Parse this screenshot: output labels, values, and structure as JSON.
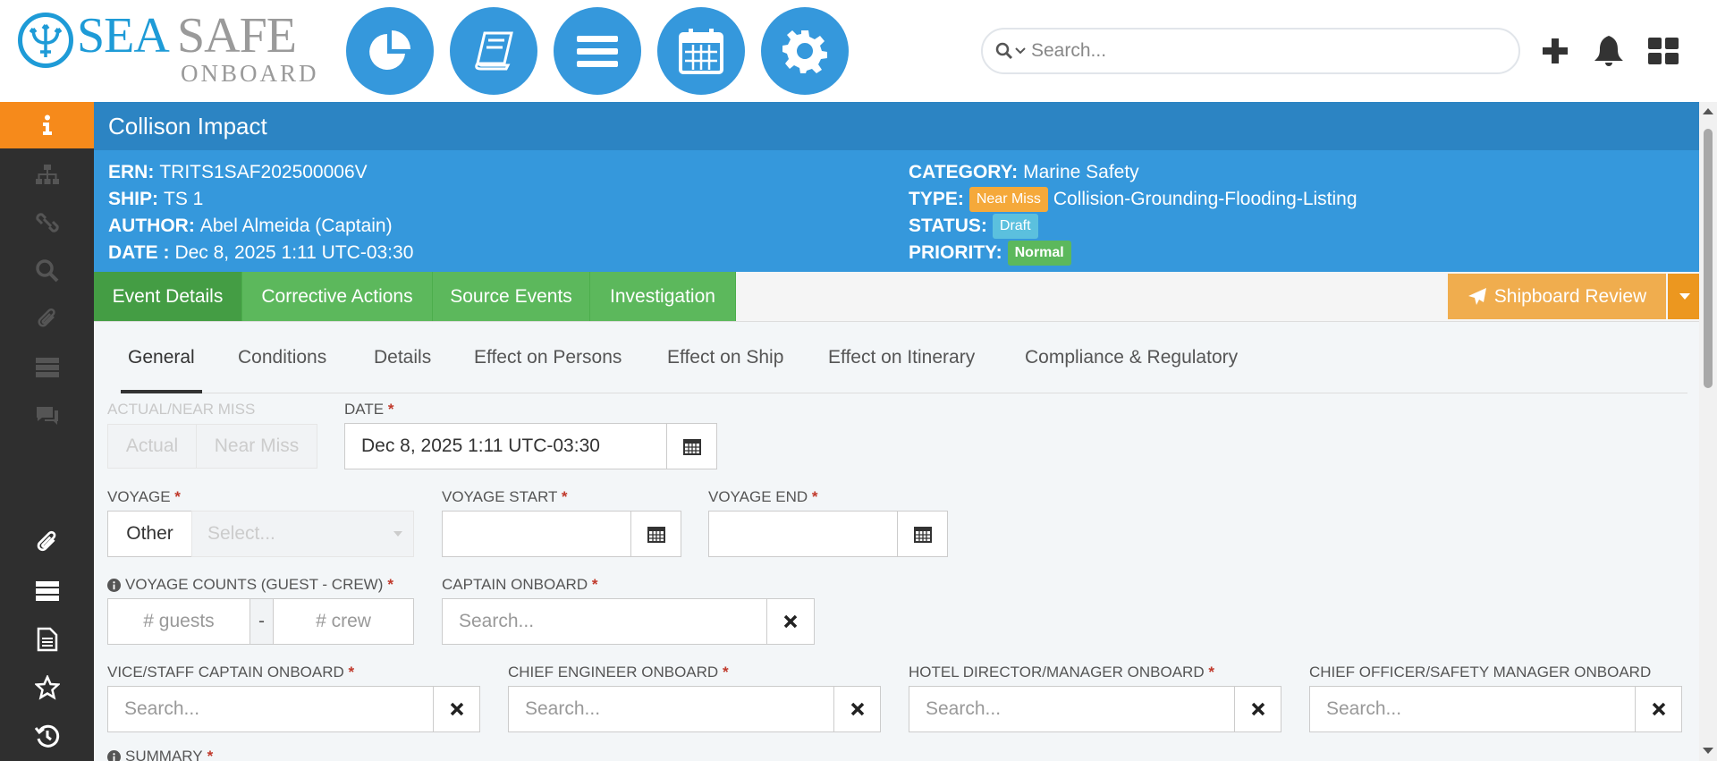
{
  "brand": {
    "part1": "SEA",
    "part2": "SAFE",
    "part3": "ONBOARD",
    "primary_color": "#1e9bd7"
  },
  "header": {
    "search_placeholder": "Search...",
    "nav_icons": [
      "pie-chart-icon",
      "book-icon",
      "menu-icon",
      "calendar-icon",
      "gear-icon"
    ]
  },
  "sidebar": {
    "top_items": [
      "info-icon",
      "sitemap-icon",
      "link-icon",
      "search-icon",
      "paperclip-icon",
      "server-icon",
      "comments-icon"
    ],
    "bottom_items": [
      "paperclip-icon",
      "server-icon",
      "document-icon",
      "star-icon",
      "history-icon"
    ]
  },
  "event": {
    "title": "Collison Impact",
    "ern_label": "ERN:",
    "ern": "TRITS1SAF202500006V",
    "ship_label": "SHIP:",
    "ship": "TS 1",
    "author_label": "AUTHOR:",
    "author": "Abel Almeida (Captain)",
    "date_label": "DATE :",
    "date": "Dec 8, 2025 1:11 UTC-03:30",
    "category_label": "CATEGORY:",
    "category": "Marine Safety",
    "type_label": "TYPE:",
    "type_badge": "Near Miss",
    "type": "Collision-Grounding-Flooding-Listing",
    "status_label": "STATUS:",
    "status": "Draft",
    "priority_label": "PRIORITY:",
    "priority": "Normal"
  },
  "tabs": [
    "Event Details",
    "Corrective Actions",
    "Source Events",
    "Investigation"
  ],
  "review_button": "Shipboard Review",
  "subtabs": [
    "General",
    "Conditions",
    "Details",
    "Effect on Persons",
    "Effect on Ship",
    "Effect on Itinerary",
    "Compliance & Regulatory"
  ],
  "form": {
    "actual_near_miss_label": "ACTUAL/NEAR MISS",
    "actual": "Actual",
    "near_miss": "Near Miss",
    "date_label": "DATE",
    "date_value": "Dec 8, 2025 1:11 UTC-03:30",
    "voyage_label": "VOYAGE",
    "voyage_other": "Other",
    "voyage_select": "Select...",
    "voyage_start_label": "VOYAGE START",
    "voyage_end_label": "VOYAGE END",
    "voyage_counts_label": "VOYAGE COUNTS (GUEST - CREW)",
    "guests_placeholder": "# guests",
    "crew_placeholder": "# crew",
    "dash": "-",
    "captain_label": "CAPTAIN ONBOARD",
    "vice_captain_label": "VICE/STAFF CAPTAIN ONBOARD",
    "chief_engineer_label": "CHIEF ENGINEER ONBOARD",
    "hotel_director_label": "HOTEL DIRECTOR/MANAGER ONBOARD",
    "chief_officer_label": "CHIEF OFFICER/SAFETY MANAGER ONBOARD",
    "search_placeholder": "Search...",
    "summary_label": "SUMMARY",
    "required_mark": "*"
  }
}
